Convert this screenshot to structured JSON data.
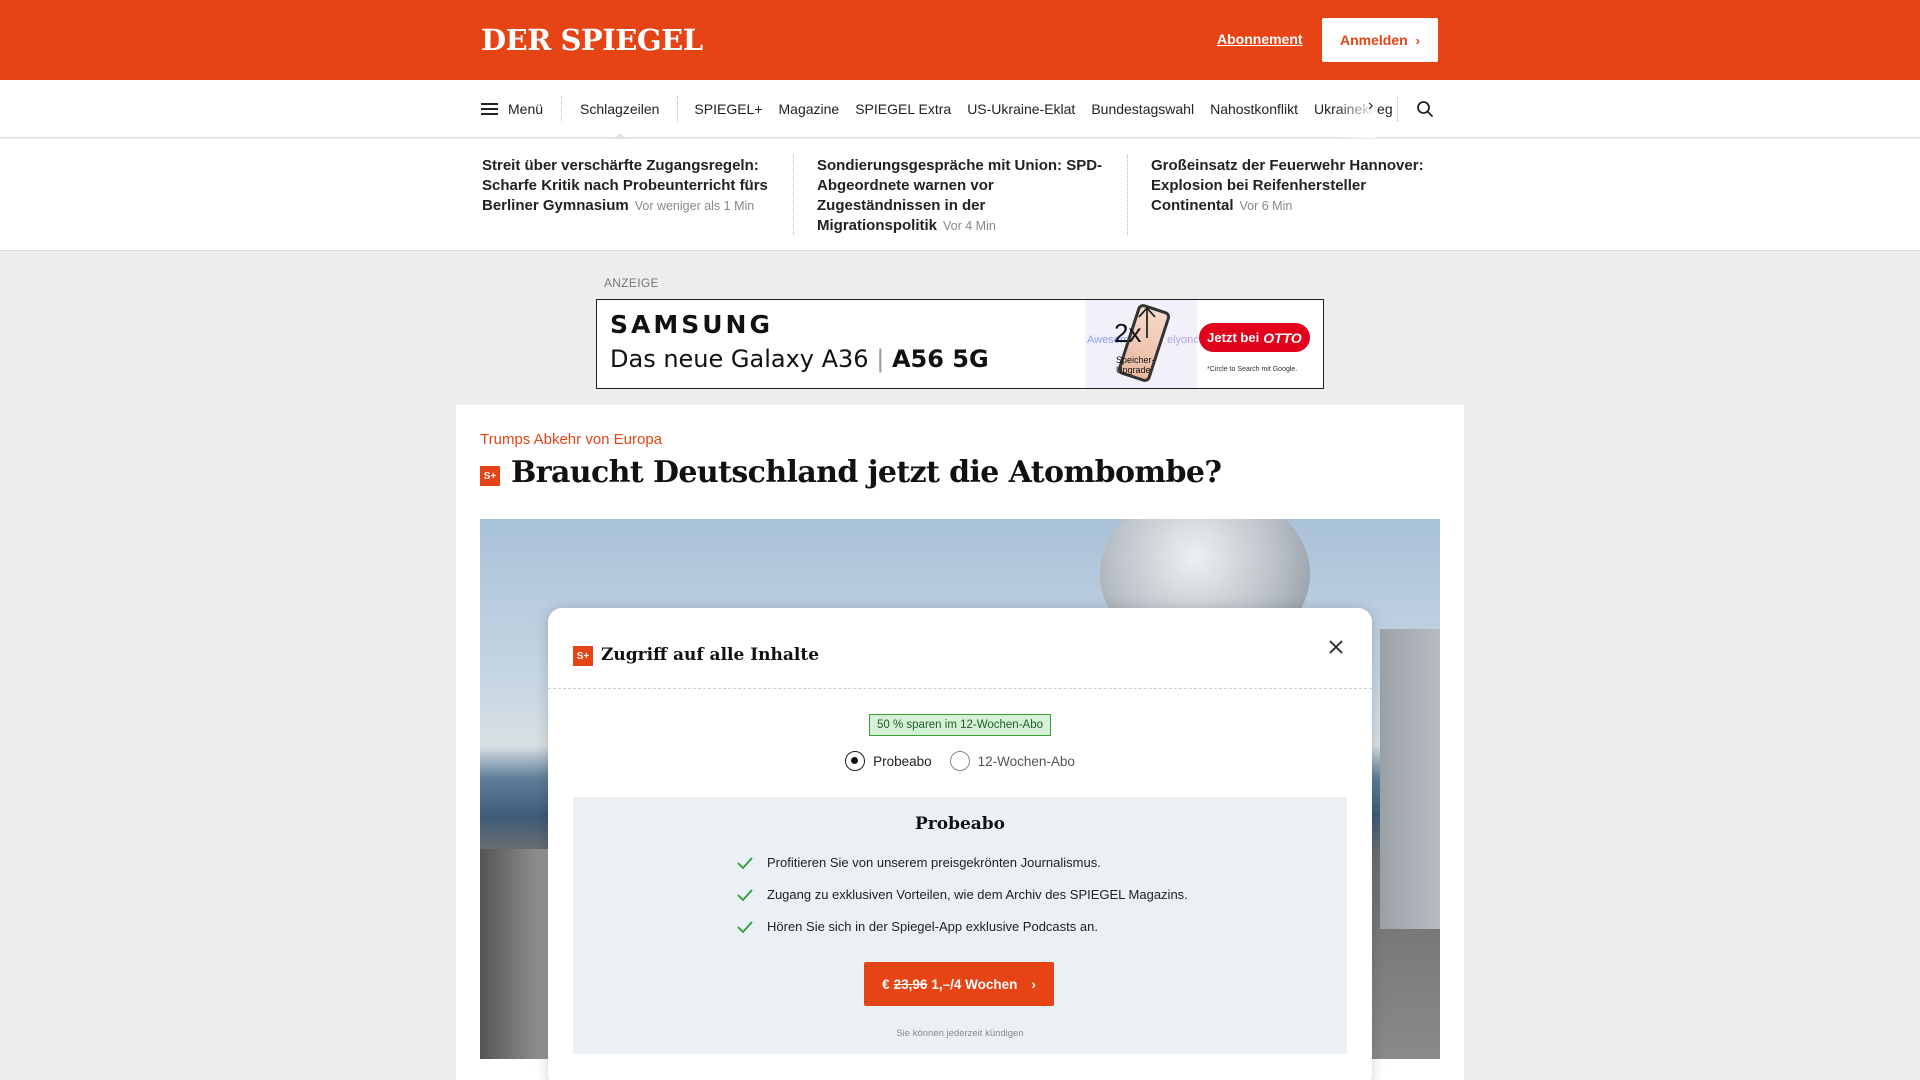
{
  "header": {
    "logo": "DER SPIEGEL",
    "abo_link": "Abonnement",
    "login_label": "Anmelden",
    "brand_color": "#e64415"
  },
  "nav": {
    "menu_label": "Menü",
    "items": [
      "Schlagzeilen",
      "SPIEGEL+",
      "Magazine",
      "SPIEGEL Extra",
      "US-Ukraine-Eklat",
      "Bundestagswahl",
      "Nahostkonflikt",
      "Ukrainekrieg"
    ],
    "next_icon": "chevron-right-icon",
    "search_icon": "search-icon"
  },
  "teasers": [
    {
      "title": "Streit über verschärfte Zugangsregeln: Scharfe Kritik nach Probeunterricht fürs Berliner Gymnasium",
      "time": "Vor weniger als 1 Min"
    },
    {
      "title": "Sondierungsgespräche mit Union: SPD-Abgeordnete warnen vor Zugeständnissen in der Migrationspolitik",
      "time": "Vor 4 Min"
    },
    {
      "title": "Großeinsatz der Feuerwehr Hannover: Explosion bei Reifenhersteller Continental",
      "time": "Vor 6 Min"
    }
  ],
  "ad": {
    "label": "ANZEIGE",
    "brand": "SAMSUNG",
    "product_a": "Das neue Galaxy A36",
    "product_b": "A56 5G",
    "side_text_left": "Awesom",
    "side_text_right": "elyonce",
    "multiplier": "2x",
    "upgrade_line1": "Speicher-",
    "upgrade_line2": "Upgrade",
    "cta_text": "Jetzt bei",
    "cta_brand": "OTTO",
    "footnote": "*Circle to Search mit Google."
  },
  "article": {
    "kicker": "Trumps Abkehr von Europa",
    "badge": "S+",
    "headline": "Braucht Deutschland jetzt die Atombombe?"
  },
  "modal": {
    "badge": "S+",
    "title": "Zugriff auf alle Inhalte",
    "save_badge": "50 % sparen im 12-Wochen-Abo",
    "radio_options": [
      {
        "label": "Probeabo",
        "selected": true
      },
      {
        "label": "12-Wochen-Abo",
        "selected": false
      }
    ],
    "plan": {
      "title": "Probeabo",
      "benefits": [
        "Profitieren Sie von unserem preisgekrönten Journalismus.",
        "Zugang zu exklusiven Vorteilen, wie dem Archiv des SPIEGEL Magazins.",
        "Hören Sie sich in der Spiegel-App exklusive Podcasts an."
      ],
      "price_currency": "€",
      "price_old": "23,96",
      "price_new": "1,–/4 Wochen",
      "cancel_note": "Sie können jederzeit kündigen"
    }
  }
}
